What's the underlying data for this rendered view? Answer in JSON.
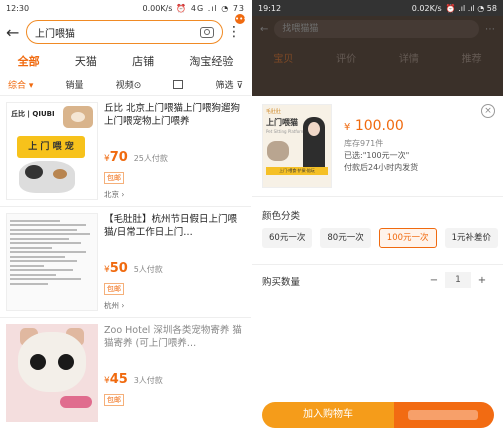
{
  "left": {
    "status": {
      "time": "12:30",
      "net": "0.00K/s",
      "icons": "⏰ 4G .ıl ◔ 73"
    },
    "search": {
      "query": "上门喂猫"
    },
    "tabs": [
      "全部",
      "天猫",
      "店铺",
      "淘宝经验"
    ],
    "filters": {
      "sort": "综合 ▾",
      "sales": "销量",
      "video": "视频⊙",
      "filter": "筛选 ⊽"
    },
    "products": [
      {
        "title": "丘比 北京上门喂猫上门喂狗遛狗上门喂宠物上门喂养",
        "price_int": "70",
        "buyers": "25人付款",
        "badge": "包邮",
        "location": "北京 ›",
        "brand": "丘比 | QIUBI",
        "banner": "上 门 喂 宠"
      },
      {
        "title": "【毛肚肚】杭州节日假日上门喂猫/日常工作日上门…",
        "price_int": "50",
        "buyers": "5人付款",
        "badge": "包邮",
        "location": "杭州 ›"
      },
      {
        "title": "Zoo Hotel 深圳各类宠物寄养 猫猫寄养 (可上门喂养…",
        "price_int": "45",
        "buyers": "3人付款",
        "badge": "包邮"
      }
    ],
    "currency": "¥"
  },
  "right": {
    "status": {
      "time": "19:12",
      "net": "0.02K/s",
      "icons": "⏰ .ıl .ıl ◔ 58"
    },
    "bg": {
      "search_placeholder": "找喂猫猫",
      "tabs": [
        "宝贝",
        "评价",
        "详情",
        "推荐"
      ]
    },
    "product": {
      "price": "100.00",
      "currency": "¥",
      "stock": "库存971件",
      "selected": "已选:\"100元一次\"",
      "shipping": "付款后24小时内发货",
      "img_logo": "毛肚肚",
      "img_title": "上门喂猫",
      "img_sub": "Pet Sitting Platform",
      "img_bar": "上门·喂食·铲屎·陪玩"
    },
    "color_label": "颜色分类",
    "options": [
      "60元一次",
      "80元一次",
      "100元一次",
      "1元补差价"
    ],
    "selected_option": 2,
    "qty_label": "购买数量",
    "qty": {
      "minus": "−",
      "value": "1",
      "plus": "+"
    },
    "close": "×",
    "add_to_cart": "加入购物车"
  },
  "colors": {
    "accent": "#f06a0f",
    "cart": "#f59c1a",
    "buy": "#f26b12"
  }
}
